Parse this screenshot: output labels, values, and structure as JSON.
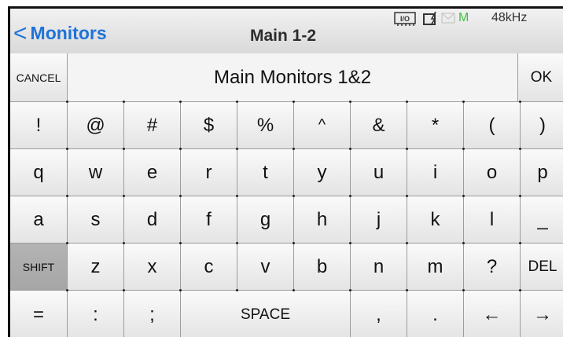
{
  "header": {
    "back_label": "Monitors",
    "title": "Main 1-2",
    "status": {
      "io_text": "I/O",
      "midi_label": "M",
      "sample_rate": "48kHz"
    }
  },
  "entry": {
    "cancel_label": "CANCEL",
    "value": "Main Monitors 1&2",
    "ok_label": "OK"
  },
  "keyboard": {
    "symbols": [
      "!",
      "@",
      "#",
      "$",
      "%",
      "^",
      "&",
      "*",
      "(",
      ")"
    ],
    "row_q": [
      "q",
      "w",
      "e",
      "r",
      "t",
      "y",
      "u",
      "i",
      "o",
      "p"
    ],
    "row_a": [
      "a",
      "s",
      "d",
      "f",
      "g",
      "h",
      "j",
      "k",
      "l",
      "_"
    ],
    "row_z": {
      "shift": "SHIFT",
      "keys": [
        "z",
        "x",
        "c",
        "v",
        "b",
        "n",
        "m",
        "?"
      ],
      "del": "DEL"
    },
    "row_bottom": {
      "equals": "=",
      "colon": ":",
      "semicolon": ";",
      "space": "SPACE",
      "comma": ",",
      "period": ".",
      "left_arrow": "←",
      "right_arrow": "→"
    }
  },
  "colors": {
    "accent": "#1e73d8",
    "midi_indicator": "#3fbf3f",
    "shift_active": "#a9a9a9"
  }
}
